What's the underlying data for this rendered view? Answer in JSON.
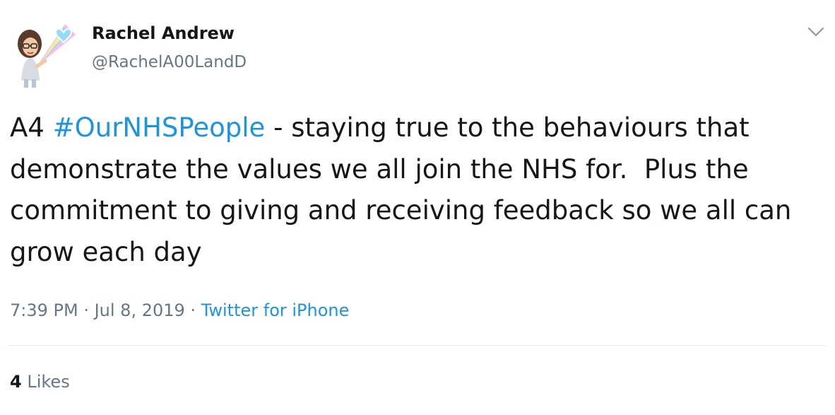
{
  "author": {
    "name": "Rachel Andrew",
    "handle": "@RachelA00LandD",
    "avatar_icon": "bitmoji-avatar-icon"
  },
  "tweet": {
    "text_before": "A4 ",
    "hashtag": "#OurNHSPeople",
    "text_after": " - staying true to the behaviours that demonstrate the values we all join the NHS for.  Plus the commitment to giving and receiving feedback so we all can grow each day"
  },
  "meta": {
    "time": "7:39 PM",
    "sep1": " · ",
    "date": "Jul 8, 2019",
    "sep2": " · ",
    "source": "Twitter for iPhone"
  },
  "stats": {
    "likes_count": "4",
    "likes_label": "Likes"
  },
  "menu": {
    "caret_icon": "chevron-down-icon"
  },
  "colors": {
    "link": "#1b95e0",
    "secondary": "#657786",
    "primary": "#14171a",
    "divider": "#e6ecf0"
  }
}
